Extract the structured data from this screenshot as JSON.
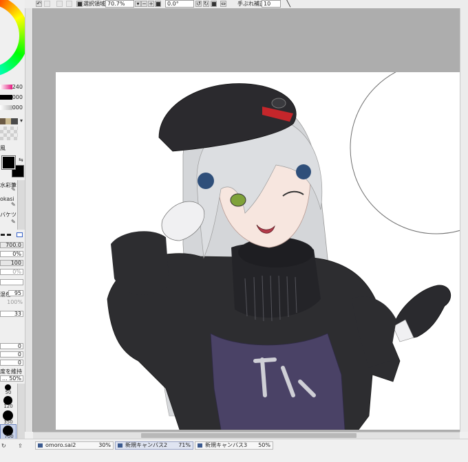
{
  "toolbar": {
    "select_label": "選択領域",
    "zoom": "70.7%",
    "rotation": "0.0°",
    "stabilizer_label": "手ぶれ補正",
    "stabilizer_value": "10"
  },
  "color_panel": {
    "sliders": [
      {
        "value": "240",
        "color": "#e4197f"
      },
      {
        "value": "000",
        "color": "#000000"
      },
      {
        "value": "000",
        "color": "#bbbbbb"
      }
    ],
    "primary_color": "#000000",
    "secondary_color": "#000000"
  },
  "tools": {
    "labels": [
      "風",
      "水彩筆",
      "okasi",
      "バケツ"
    ]
  },
  "brush": {
    "size": "700.0",
    "min_size": "0%",
    "density": "100",
    "min_density": "0%",
    "blend_label": "混色",
    "blend_value": "95",
    "blend_pct": "100%",
    "stroke": "33",
    "opts": [
      "0",
      "0",
      "0"
    ],
    "keep_label": "度を維持",
    "keep_value": "... 50%"
  },
  "brush_sizes": [
    {
      "label": "50"
    },
    {
      "label": "120"
    },
    {
      "label": "350"
    },
    {
      "label": "700"
    }
  ],
  "tabs": [
    {
      "name": "omoro.sai2",
      "zoom": "30%",
      "active": false
    },
    {
      "name": "新規キャンバス2",
      "zoom": "71%",
      "active": true
    },
    {
      "name": "新規キャンバス3",
      "zoom": "50%",
      "active": false
    }
  ]
}
